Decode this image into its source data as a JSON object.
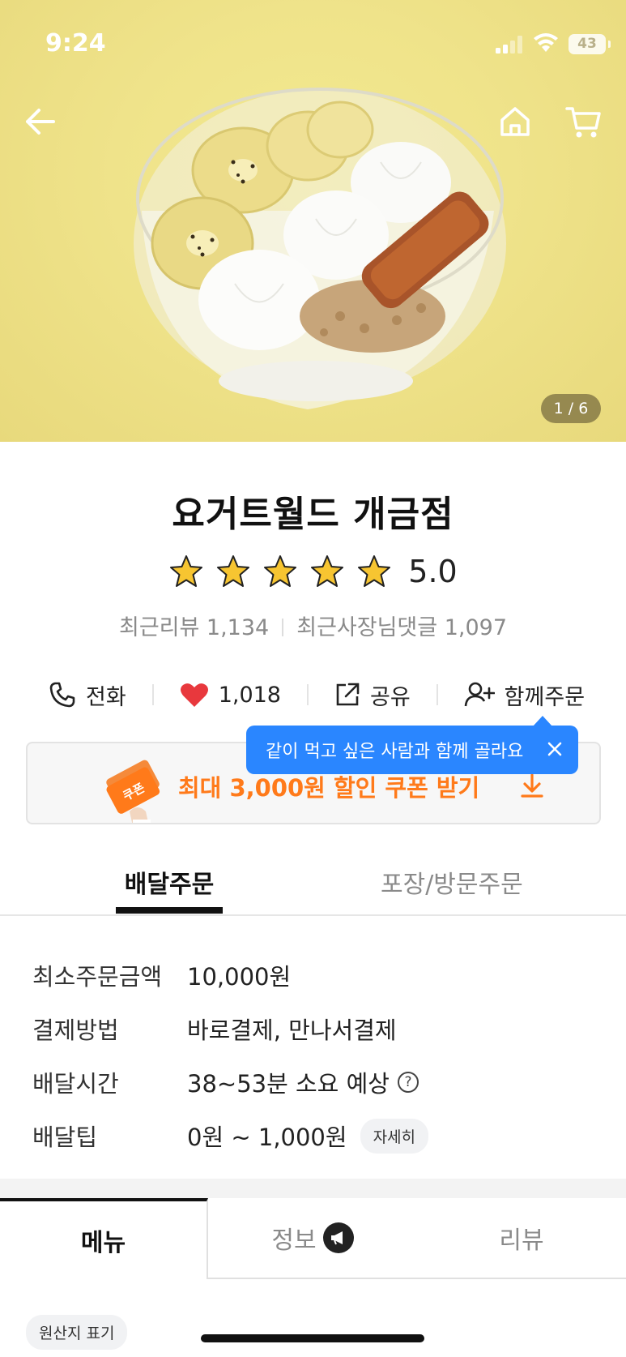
{
  "status_bar": {
    "time": "9:24",
    "battery": "43"
  },
  "hero": {
    "image_counter": "1 / 6"
  },
  "store": {
    "name": "요거트월드 개금점",
    "rating": "5.0",
    "recent_reviews": "최근리뷰 1,134",
    "owner_replies": "최근사장님댓글 1,097"
  },
  "actions": {
    "call": "전화",
    "likes": "1,018",
    "share": "공유",
    "group_order": "함께주문"
  },
  "tooltip": {
    "text": "같이 먹고 싶은 사람과 함께 골라요"
  },
  "coupon": {
    "text": "최대 3,000원 할인 쿠폰 받기",
    "badge": "쿠폰"
  },
  "order_tabs": {
    "delivery": "배달주문",
    "pickup": "포장/방문주문"
  },
  "delivery_info": [
    {
      "label": "최소주문금액",
      "value": "10,000원"
    },
    {
      "label": "결제방법",
      "value": "바로결제, 만나서결제"
    },
    {
      "label": "배달시간",
      "value": "38~53분 소요 예상"
    },
    {
      "label": "배달팁",
      "value": "0원 ~ 1,000원",
      "detail": "자세히"
    }
  ],
  "tabs": {
    "menu": "메뉴",
    "info": "정보",
    "review": "리뷰"
  },
  "origin_label": "원산지 표기",
  "colors": {
    "accent_orange": "#ff7a1a",
    "tooltip_blue": "#2a86ff",
    "heart_red": "#e8383d",
    "star_gold": "#f7c531"
  }
}
